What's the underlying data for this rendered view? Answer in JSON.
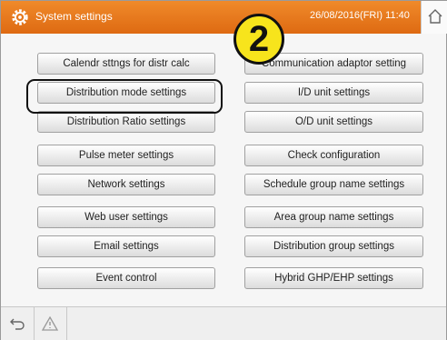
{
  "header": {
    "title": "System settings",
    "datetime": "26/08/2016(FRI) 11:40",
    "icon": "gear-icon",
    "home_icon": "home-icon",
    "color": "#e87a1e"
  },
  "buttons_left": [
    "Calendr sttngs for distr calc",
    "Distribution mode settings",
    "Distribution Ratio settings",
    "Pulse meter settings",
    "Network settings",
    "Web user settings",
    "Email settings",
    "Event control"
  ],
  "buttons_right": [
    "Communication adaptor setting",
    "I/D unit settings",
    "O/D unit settings",
    "Check configuration",
    "Schedule group name settings",
    "Area group name settings",
    "Distribution group settings",
    "Hybrid GHP/EHP settings"
  ],
  "marker": {
    "label": "2"
  },
  "footer": {
    "back_icon": "back-arrow-icon",
    "warning_icon": "warning-icon"
  }
}
